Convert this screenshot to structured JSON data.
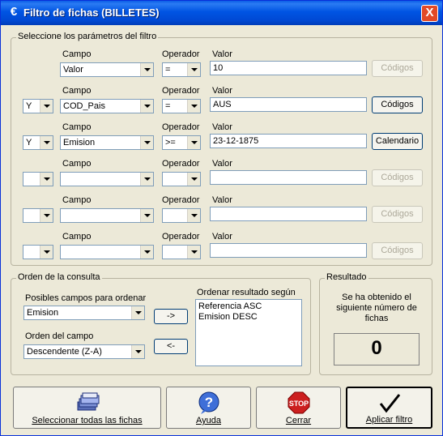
{
  "window": {
    "title": "Filtro de fichas (BILLETES)",
    "icon": "euro-icon",
    "close": "X"
  },
  "filter": {
    "legend": "Seleccione los parámetros del filtro",
    "rows": [
      {
        "conn": "",
        "campo_label": "Campo",
        "campo": "Valor",
        "op_label": "Operador",
        "op": "=",
        "valor_label": "Valor",
        "valor": "10",
        "btn": "Códigos"
      },
      {
        "conn": "Y",
        "campo_label": "Campo",
        "campo": "COD_Pais",
        "op_label": "Operador",
        "op": "=",
        "valor_label": "Valor",
        "valor": "AUS",
        "btn": "Códigos"
      },
      {
        "conn": "Y",
        "campo_label": "Campo",
        "campo": "Emision",
        "op_label": "Operador",
        "op": ">=",
        "valor_label": "Valor",
        "valor": "23-12-1875",
        "btn": "Calendario"
      },
      {
        "conn": "",
        "campo_label": "Campo",
        "campo": "",
        "op_label": "Operador",
        "op": "",
        "valor_label": "Valor",
        "valor": "",
        "btn": "Códigos"
      },
      {
        "conn": "",
        "campo_label": "Campo",
        "campo": "",
        "op_label": "Operador",
        "op": "",
        "valor_label": "Valor",
        "valor": "",
        "btn": "Códigos"
      },
      {
        "conn": "",
        "campo_label": "Campo",
        "campo": "",
        "op_label": "Operador",
        "op": "",
        "valor_label": "Valor",
        "valor": "",
        "btn": "Códigos"
      }
    ]
  },
  "order": {
    "legend": "Orden de la consulta",
    "possible_label": "Posibles campos para ordenar",
    "possible_value": "Emision",
    "direction_label": "Orden del campo",
    "direction_value": "Descendente (Z-A)",
    "add_btn": "->",
    "remove_btn": "<-",
    "result_label": "Ordenar resultado según",
    "result_items": [
      "Referencia ASC",
      "Emision DESC"
    ]
  },
  "result": {
    "legend": "Resultado",
    "text": "Se ha obtenido el siguiente número de fichas",
    "count": "0"
  },
  "buttons": {
    "select_all": "Seleccionar todas las fichas",
    "help": "Ayuda",
    "close": "Cerrar",
    "apply": "Aplicar filtro",
    "stop_text": "STOP"
  }
}
